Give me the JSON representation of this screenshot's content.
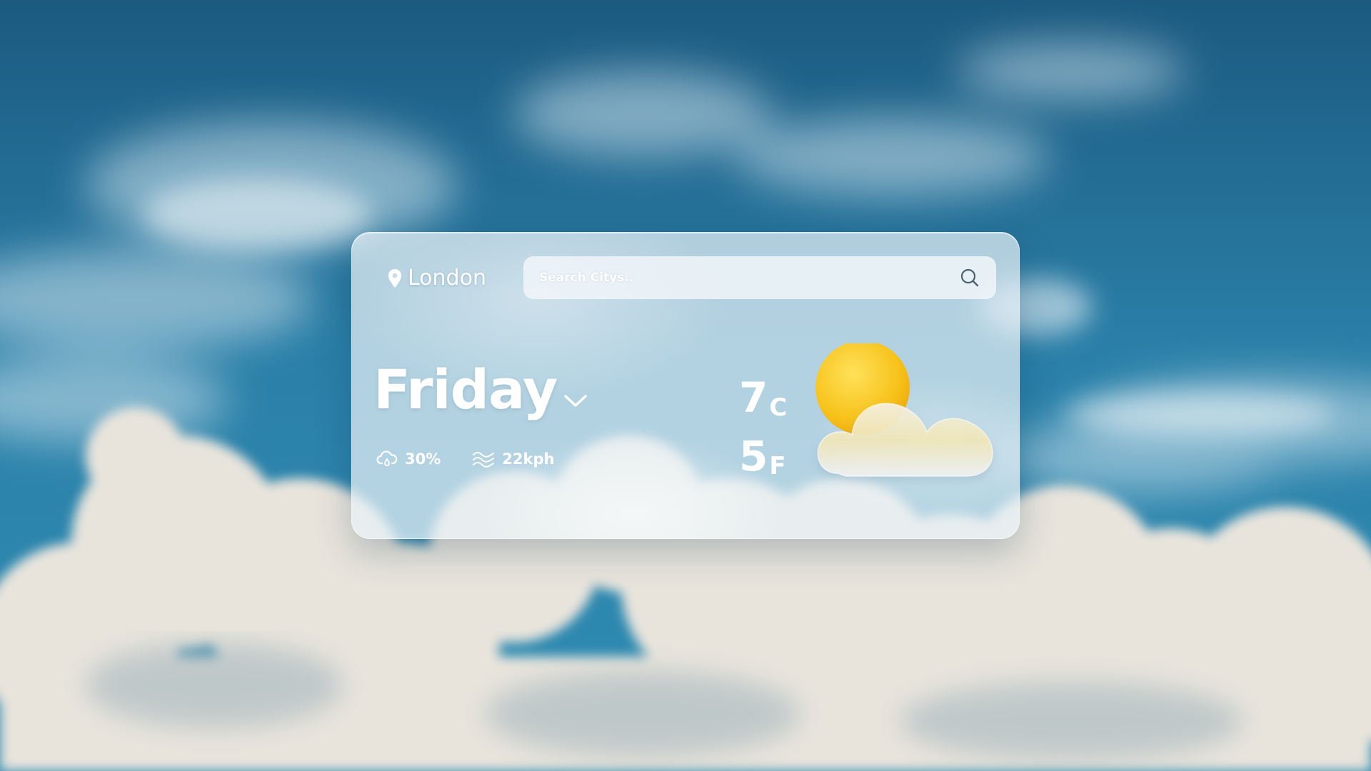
{
  "location": {
    "city": "London",
    "icon": "map-pin-icon"
  },
  "search": {
    "placeholder": "Search Citys..",
    "icon": "search-icon"
  },
  "forecast": {
    "day": "Friday",
    "day_toggle_icon": "chevron-down-icon",
    "precipitation": {
      "value": "30%",
      "icon": "cloud-rain-icon"
    },
    "wind": {
      "value": "22kph",
      "icon": "wind-icon"
    },
    "temp_c": {
      "value": "7",
      "unit": "C"
    },
    "temp_f": {
      "value": "5",
      "unit": "F"
    },
    "condition_icon": "partly-cloudy-icon"
  },
  "colors": {
    "sky": "#2a7ea8",
    "card": "#e8f1f7",
    "sun": "#f7c21a",
    "text": "#ffffff"
  }
}
